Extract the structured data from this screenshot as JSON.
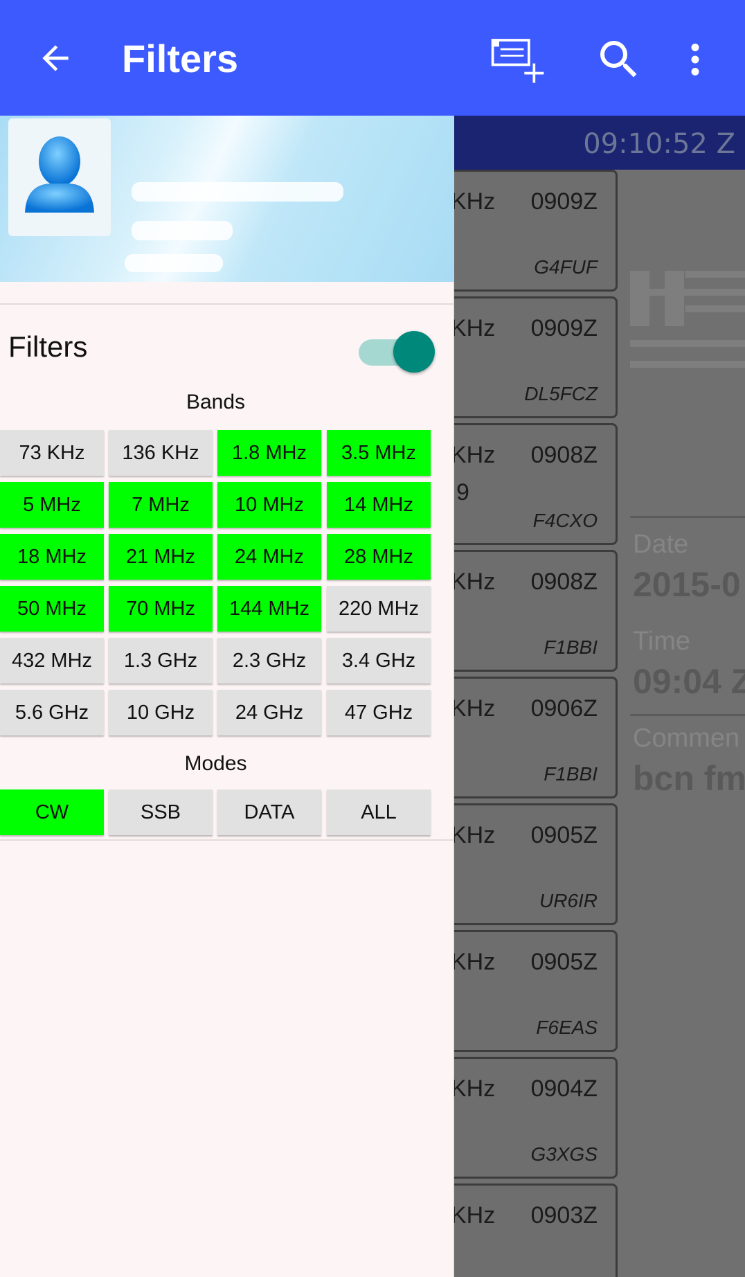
{
  "appbar": {
    "title": "Filters",
    "icons": [
      "arrow-back-icon",
      "add-list-icon",
      "search-icon",
      "more-vert-icon"
    ]
  },
  "background": {
    "clock": "09:10:52 Z",
    "spots": [
      {
        "freq": "KHz",
        "zulu": "0909Z",
        "extra": "",
        "call": "G4FUF"
      },
      {
        "freq": "KHz",
        "zulu": "0909Z",
        "extra": "",
        "call": "DL5FCZ"
      },
      {
        "freq": "KHz",
        "zulu": "0908Z",
        "extra": "9",
        "call": "F4CXO"
      },
      {
        "freq": "KHz",
        "zulu": "0908Z",
        "extra": "",
        "call": "F1BBI"
      },
      {
        "freq": "KHz",
        "zulu": "0906Z",
        "extra": "",
        "call": "F1BBI"
      },
      {
        "freq": "KHz",
        "zulu": "0905Z",
        "extra": "",
        "call": "UR6IR"
      },
      {
        "freq": "KHz",
        "zulu": "0905Z",
        "extra": "",
        "call": "F6EAS"
      },
      {
        "freq": "KHz",
        "zulu": "0904Z",
        "extra": "",
        "call": "G3XGS"
      },
      {
        "freq": "KHz",
        "zulu": "0903Z",
        "extra": "",
        "call": ""
      }
    ],
    "detail": {
      "date_label": "Date",
      "date_value": "2015-0",
      "time_label": "Time",
      "time_value": "09:04 Z",
      "comment_label": "Commen",
      "comment_value": "bcn fm"
    }
  },
  "drawer": {
    "filters_label": "Filters",
    "filters_enabled": true,
    "bands_title": "Bands",
    "bands": [
      {
        "label": "73 KHz",
        "on": false
      },
      {
        "label": "136 KHz",
        "on": false
      },
      {
        "label": "1.8 MHz",
        "on": true
      },
      {
        "label": "3.5 MHz",
        "on": true
      },
      {
        "label": "5 MHz",
        "on": true
      },
      {
        "label": "7 MHz",
        "on": true
      },
      {
        "label": "10 MHz",
        "on": true
      },
      {
        "label": "14 MHz",
        "on": true
      },
      {
        "label": "18 MHz",
        "on": true
      },
      {
        "label": "21 MHz",
        "on": true
      },
      {
        "label": "24 MHz",
        "on": true
      },
      {
        "label": "28 MHz",
        "on": true
      },
      {
        "label": "50 MHz",
        "on": true
      },
      {
        "label": "70 MHz",
        "on": true
      },
      {
        "label": "144 MHz",
        "on": true
      },
      {
        "label": "220 MHz",
        "on": false
      },
      {
        "label": "432 MHz",
        "on": false
      },
      {
        "label": "1.3 GHz",
        "on": false
      },
      {
        "label": "2.3 GHz",
        "on": false
      },
      {
        "label": "3.4 GHz",
        "on": false
      },
      {
        "label": "5.6 GHz",
        "on": false
      },
      {
        "label": "10 GHz",
        "on": false
      },
      {
        "label": "24 GHz",
        "on": false
      },
      {
        "label": "47 GHz",
        "on": false
      }
    ],
    "modes_title": "Modes",
    "modes": [
      {
        "label": "CW",
        "on": true
      },
      {
        "label": "SSB",
        "on": false
      },
      {
        "label": "DATA",
        "on": false
      },
      {
        "label": "ALL",
        "on": false
      }
    ],
    "colors": {
      "on": "#00ff00",
      "off": "#e1e1e1",
      "accent": "#00897b",
      "appbar": "#3d5afe"
    }
  }
}
